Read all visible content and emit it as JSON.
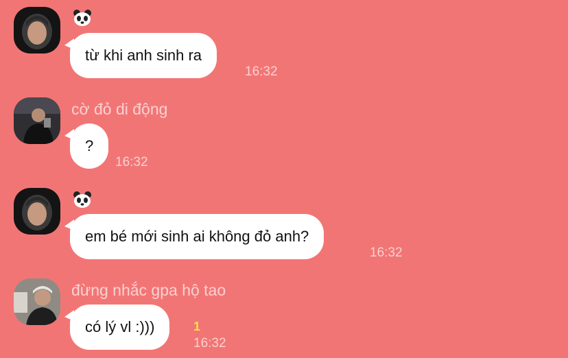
{
  "colors": {
    "background": "#f27575",
    "bubble": "#ffffff",
    "meta_text": "#fad1d1",
    "read_count": "#ffe24a"
  },
  "messages": [
    {
      "sender_icon": "panda-icon",
      "sender": "",
      "text": "từ khi anh sinh ra",
      "time": "16:32"
    },
    {
      "sender": "cờ đỏ di động",
      "text": "?",
      "time": "16:32"
    },
    {
      "sender_icon": "panda-icon",
      "sender": "",
      "text": "em bé mới sinh ai không đỏ anh?",
      "time": "16:32"
    },
    {
      "sender": "đừng nhắc gpa hộ tao",
      "text": "có lý vl :)))",
      "time": "16:32",
      "read_count": "1"
    }
  ]
}
